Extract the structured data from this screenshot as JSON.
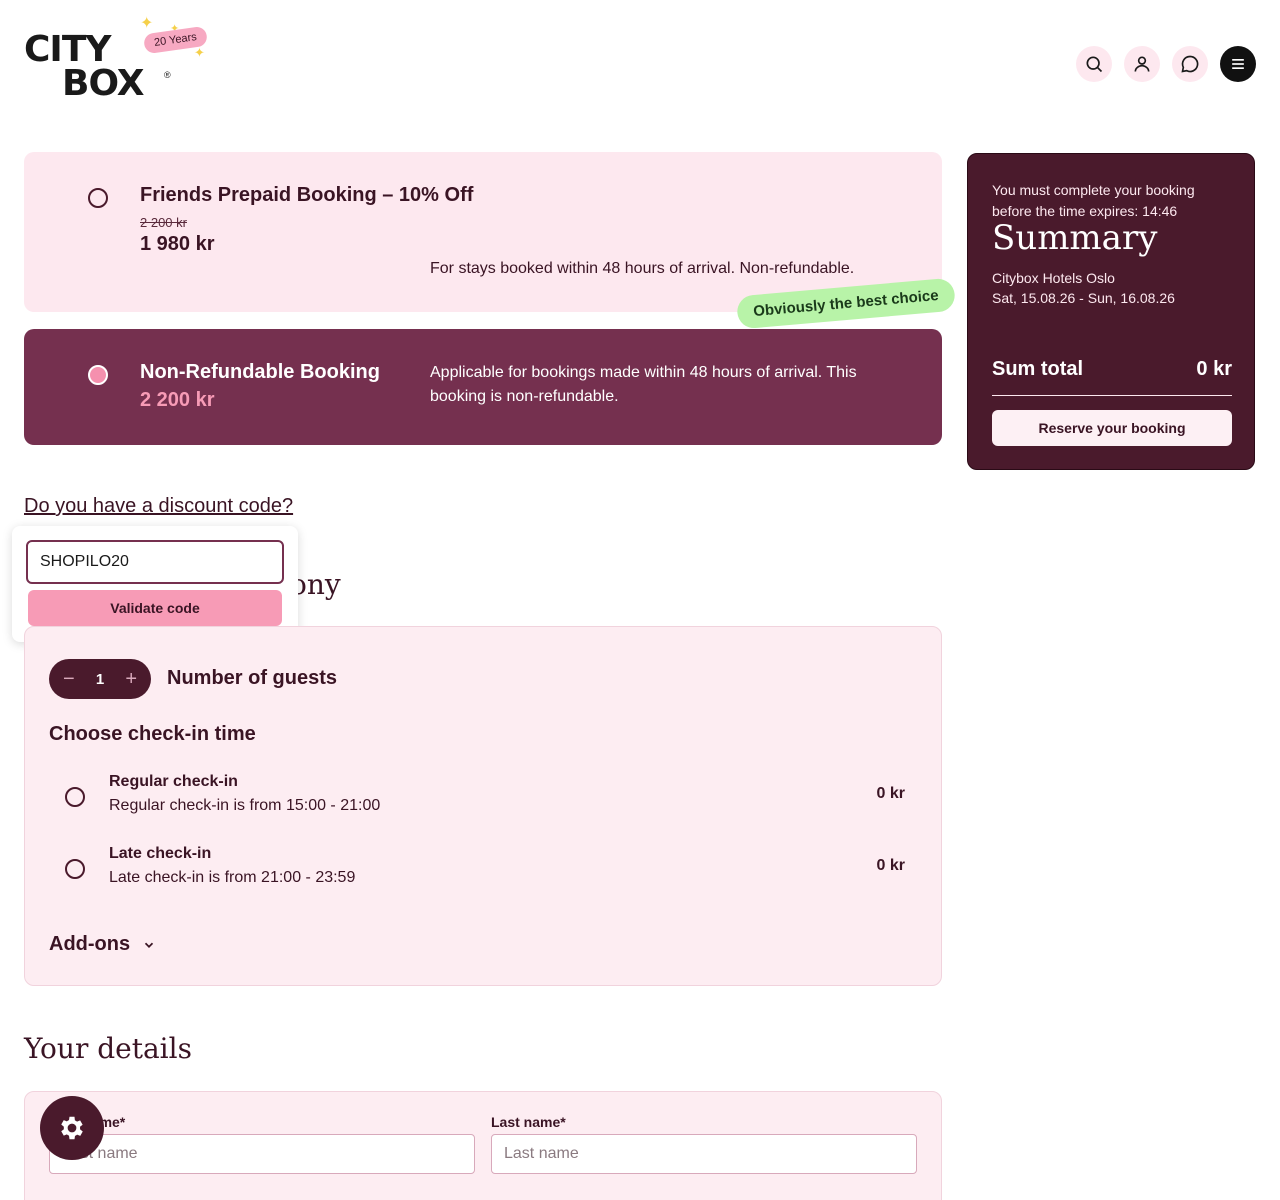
{
  "header": {
    "logo_line1": "CITY",
    "logo_line2": "BOX",
    "logo_reg": "®",
    "years_badge": "20 Years",
    "icons": [
      "search-icon",
      "user-icon",
      "chat-icon",
      "menu-icon"
    ]
  },
  "rates": [
    {
      "title": "Friends Prepaid Booking – 10% Off",
      "old_price": "2 200 kr",
      "price": "1 980 kr",
      "description": "For stays booked within 48 hours of arrival. Non-refundable.",
      "selected": false
    },
    {
      "title": "Non-Refundable Booking",
      "price": "2 200 kr",
      "description": "Applicable for bookings made within 48 hours of arrival. This booking is non-refundable.",
      "selected": true
    }
  ],
  "best_badge": "Obviously the best choice",
  "discount": {
    "link_label": "Do you have a discount code?",
    "input_value": "SHOPILO20",
    "validate_label": "Validate code"
  },
  "section_partial_title": "ony",
  "guests": {
    "count": "1",
    "minus": "−",
    "plus": "+",
    "label": "Number of guests"
  },
  "checkin": {
    "title": "Choose check-in time",
    "options": [
      {
        "name": "Regular check-in",
        "desc": "Regular check-in is from 15:00 - 21:00",
        "price": "0 kr"
      },
      {
        "name": "Late check-in",
        "desc": "Late check-in is from 21:00 - 23:59",
        "price": "0 kr"
      }
    ]
  },
  "addons_label": "Add-ons",
  "details": {
    "title": "Your details",
    "first_name_label": "First name*",
    "first_name_placeholder": "First name",
    "last_name_label": "Last name*",
    "last_name_placeholder": "Last name"
  },
  "summary": {
    "timer_text": "You must complete your booking before the time expires: 14:46",
    "title": "Summary",
    "hotel": "Citybox Hotels Oslo",
    "dates": "Sat, 15.08.26 - Sun, 16.08.26",
    "total_label": "Sum total",
    "total_value": "0 kr",
    "reserve_label": "Reserve your booking"
  },
  "colors": {
    "brand_dark": "#4a1a2c",
    "brand_mid": "#75304f",
    "pink_light": "#fde8ef",
    "pink_accent": "#f79bb6",
    "green_badge": "#b8f3a8"
  }
}
